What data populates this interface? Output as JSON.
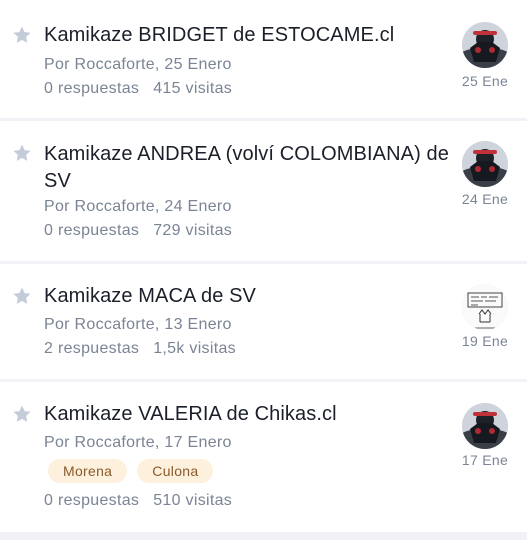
{
  "topics": [
    {
      "title": "Kamikaze BRIDGET de ESTOCAME.cl",
      "meta": "Por Roccaforte, 25 Enero",
      "replies": "0 respuestas",
      "views": "415 visitas",
      "date": "25 Ene",
      "avatar": "bike-avatar",
      "tags": []
    },
    {
      "title_line1": "Kamikaze ANDREA (volví COLOMBIANA) de",
      "title_line2": "SV",
      "meta": "Por Roccaforte, 24 Enero",
      "replies": "0 respuestas",
      "views": "729 visitas",
      "date": "24 Ene",
      "avatar": "bike-avatar",
      "tags": []
    },
    {
      "title": "Kamikaze MACA de SV",
      "meta": "Por Roccaforte, 13 Enero",
      "replies": "2 respuestas",
      "views": "1,5k visitas",
      "date": "19 Ene",
      "avatar": "sketch-avatar",
      "tags": []
    },
    {
      "title": "Kamikaze VALERIA de Chikas.cl",
      "meta": "Por Roccaforte, 17 Enero",
      "replies": "0 respuestas",
      "views": "510 visitas",
      "date": "17 Ene",
      "avatar": "bike-avatar",
      "tags": [
        "Morena",
        "Culona"
      ]
    }
  ],
  "colors": {
    "title": "#1b1f29",
    "meta": "#7a8494",
    "star": "#c3ccd8",
    "tag_bg": "#fdf0dc",
    "tag_text": "#8a5a2b",
    "divider": "#f0f2f5"
  }
}
